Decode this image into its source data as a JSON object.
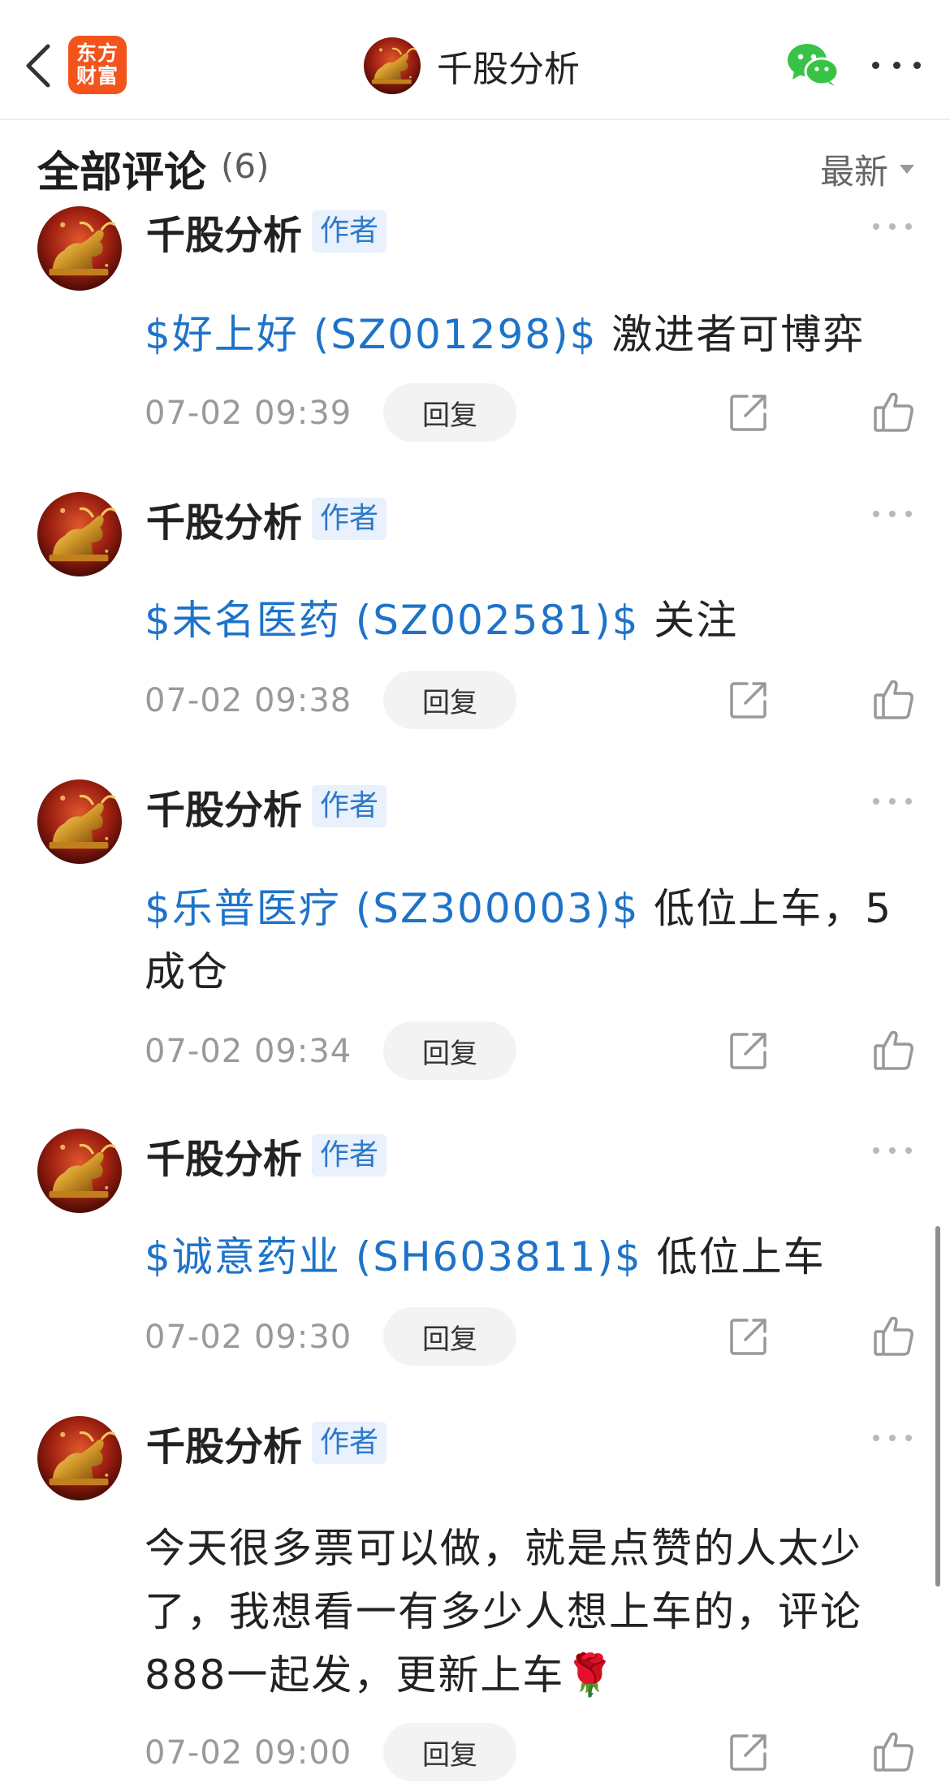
{
  "header": {
    "logo_text": "东方\n财富",
    "title": "千股分析",
    "brand_color": "#f2541b"
  },
  "section": {
    "title": "全部评论",
    "count": "(6)",
    "sort_label": "最新"
  },
  "comments": [
    {
      "author": "千股分析",
      "badge": "作者",
      "stock_tag": "$好上好 (SZ001298)$",
      "text": " 激进者可博弈",
      "time": "07-02 09:39",
      "reply_label": "回复"
    },
    {
      "author": "千股分析",
      "badge": "作者",
      "stock_tag": "$未名医药 (SZ002581)$",
      "text": " 关注",
      "time": "07-02 09:38",
      "reply_label": "回复"
    },
    {
      "author": "千股分析",
      "badge": "作者",
      "stock_tag": "$乐普医疗 (SZ300003)$",
      "text": " 低位上车，5成仓",
      "time": "07-02 09:34",
      "reply_label": "回复"
    },
    {
      "author": "千股分析",
      "badge": "作者",
      "stock_tag": "$诚意药业 (SH603811)$",
      "text": " 低位上车",
      "time": "07-02 09:30",
      "reply_label": "回复"
    },
    {
      "author": "千股分析",
      "badge": "作者",
      "stock_tag": "",
      "text": "今天很多票可以做，就是点赞的人太少了，我想看一有多少人想上车的，评论888一起发，更新上车🌹",
      "time": "07-02 09:00",
      "reply_label": "回复"
    }
  ],
  "icons": {
    "back": "chevron-left-icon",
    "wechat": "wechat-icon",
    "more": "more-horizontal-icon",
    "share": "share-icon",
    "like": "thumbs-up-icon"
  },
  "colors": {
    "link": "#1e73c9",
    "badge_bg": "#e8f1fc",
    "badge_text": "#2e79c9",
    "wechat_green": "#39c346"
  }
}
